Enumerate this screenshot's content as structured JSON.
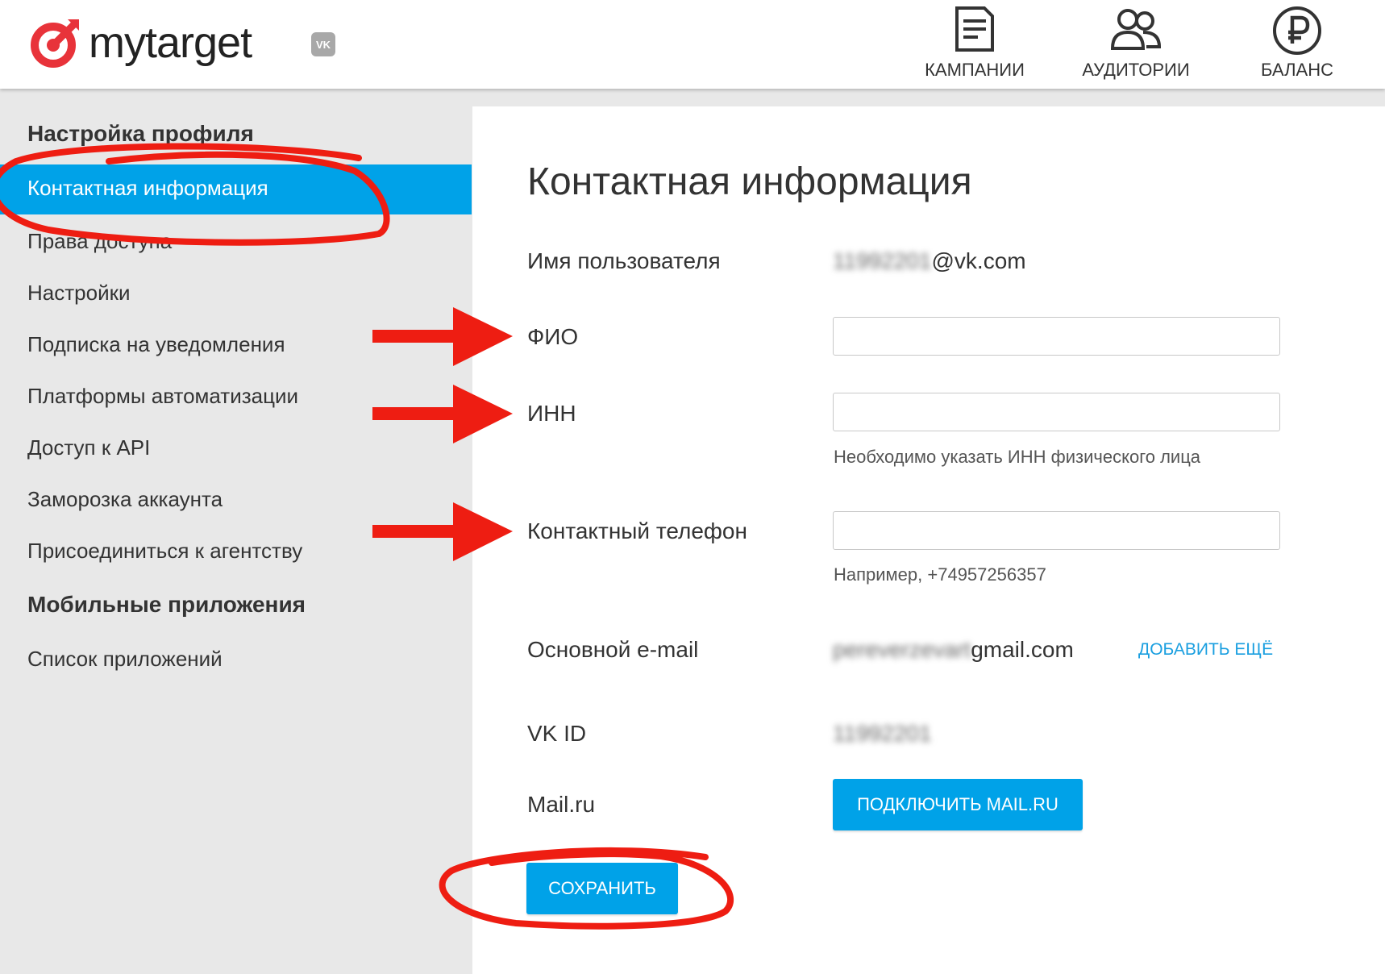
{
  "header": {
    "logo_text": "mytarget",
    "vk_badge": "VK",
    "nav": [
      {
        "label": "КАМПАНИИ",
        "icon": "campaign-document-icon"
      },
      {
        "label": "АУДИТОРИИ",
        "icon": "audience-people-icon"
      },
      {
        "label": "БАЛАНС",
        "icon": "ruble-balance-icon"
      }
    ]
  },
  "sidebar": {
    "section1_title": "Настройка профиля",
    "items": [
      "Контактная информация",
      "Права доступа",
      "Настройки",
      "Подписка на уведомления",
      "Платформы автоматизации",
      "Доступ к API",
      "Заморозка аккаунта",
      "Присоединиться к агентству"
    ],
    "section2_title": "Мобильные приложения",
    "section2_items": [
      "Список приложений"
    ]
  },
  "main": {
    "title": "Контактная информация",
    "username_label": "Имя пользователя",
    "username_blurred": "11992201",
    "username_domain": "@vk.com",
    "fio_label": "ФИО",
    "fio_value": "",
    "inn_label": "ИНН",
    "inn_value": "",
    "inn_hint": "Необходимо указать ИНН физического лица",
    "phone_label": "Контактный телефон",
    "phone_value": "",
    "phone_hint": "Например, +74957256357",
    "email_label": "Основной e-mail",
    "email_blurred": "pereverzevart",
    "email_domain": "gmail.com",
    "add_more_label": "ДОБАВИТЬ ЕЩЁ",
    "vkid_label": "VK ID",
    "vkid_blurred": "11992201",
    "mailru_label": "Mail.ru",
    "connect_mailru_label": "ПОДКЛЮЧИТЬ MAIL.RU",
    "save_label": "СОХРАНИТЬ"
  },
  "colors": {
    "accent": "#00a2e8",
    "logo_red": "#e8333a",
    "annotation_red": "#ee1d12"
  }
}
